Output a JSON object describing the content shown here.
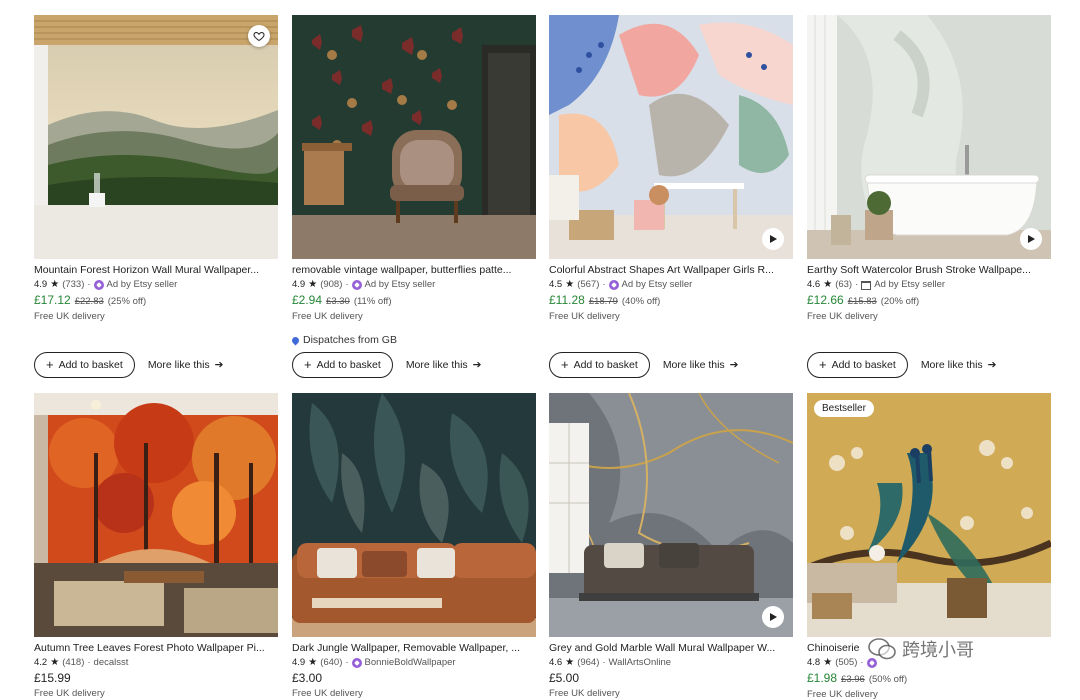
{
  "actions": {
    "add_label": "Add to basket",
    "more_label": "More like this"
  },
  "products": [
    {
      "title": "Mountain Forest Horizon Wall Mural Wallpaper...",
      "rating": "4.9",
      "reviews": "(733)",
      "seller_type": "ad",
      "seller": "Ad by Etsy seller",
      "price": "£17.12",
      "original": "£22.83",
      "discount": "(25% off)",
      "delivery": "Free UK delivery",
      "favorite_icon": "heart-icon"
    },
    {
      "title": "removable vintage wallpaper, butterflies patte...",
      "rating": "4.9",
      "reviews": "(908)",
      "seller_type": "ad",
      "seller": "Ad by Etsy seller",
      "price": "£2.94",
      "original": "£3.30",
      "discount": "(11% off)",
      "delivery": "Free UK delivery",
      "dispatch": "Dispatches from GB"
    },
    {
      "title": "Colorful Abstract Shapes Art Wallpaper Girls R...",
      "rating": "4.5",
      "reviews": "(567)",
      "seller_type": "ad",
      "seller": "Ad by Etsy seller",
      "price": "£11.28",
      "original": "£18.79",
      "discount": "(40% off)",
      "delivery": "Free UK delivery",
      "video_icon": "play-icon"
    },
    {
      "title": "Earthy Soft Watercolor Brush Stroke Wallpape...",
      "rating": "4.6",
      "reviews": "(63)",
      "seller_type": "shop",
      "seller": "Ad by Etsy seller",
      "price": "£12.66",
      "original": "£15.83",
      "discount": "(20% off)",
      "delivery": "Free UK delivery",
      "video_icon": "play-icon"
    },
    {
      "title": "Autumn Tree Leaves Forest Photo Wallpaper Pi...",
      "rating": "4.2",
      "reviews": "(418)",
      "seller_type": "none",
      "seller": "decalsst",
      "price": "£15.99",
      "delivery": "Free UK delivery"
    },
    {
      "title": "Dark Jungle Wallpaper, Removable Wallpaper, ...",
      "rating": "4.9",
      "reviews": "(640)",
      "seller_type": "star",
      "seller": "BonnieBoldWallpaper",
      "price": "£3.00",
      "delivery": "Free UK delivery"
    },
    {
      "title": "Grey and Gold Marble Wall Mural Wallpaper W...",
      "rating": "4.6",
      "reviews": "(964)",
      "seller_type": "none",
      "seller": "WallArtsOnline",
      "price": "£5.00",
      "delivery": "Free UK delivery",
      "video_icon": "play-icon"
    },
    {
      "title": "Chinoiserie",
      "rating": "4.8",
      "reviews": "(505)",
      "seller_type": "star",
      "seller": "",
      "price": "£1.98",
      "original": "£3.96",
      "discount": "(50% off)",
      "delivery": "Free UK delivery",
      "badge": "Bestseller"
    }
  ],
  "watermark": {
    "text": "跨境小哥"
  },
  "colors": {
    "sale_price": "#258635",
    "star_seller": "#9560d8",
    "pin": "#3f6ad8"
  }
}
